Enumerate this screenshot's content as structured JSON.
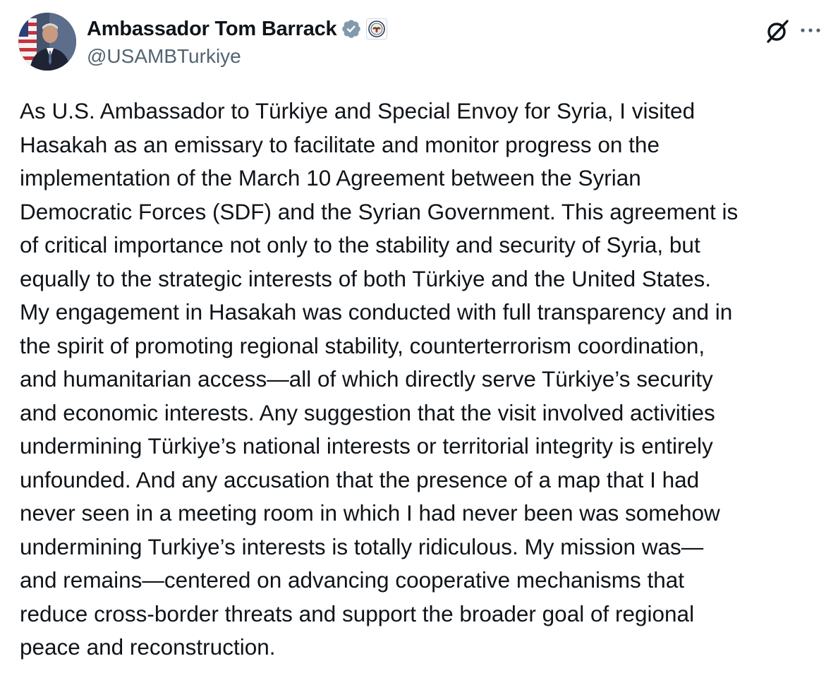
{
  "author": {
    "display_name": "Ambassador Tom Barrack",
    "handle": "@USAMBTurkiye",
    "verified_badge": "verified-icon",
    "affiliation_badge": "us-state-department-seal-icon"
  },
  "actions": {
    "grok_icon": "grok-icon",
    "more_icon": "more-icon"
  },
  "colors": {
    "text": "#0f1419",
    "secondary_text": "#536471",
    "verified_badge": "#829aab"
  },
  "tweet": {
    "lines": [
      "As U.S. Ambassador to Türkiye and Special Envoy for Syria, I visited",
      "Hasakah as an emissary to facilitate and monitor progress on the",
      "implementation of the March 10 Agreement between the Syrian",
      "Democratic Forces (SDF) and the Syrian Government. This agreement is",
      "of critical importance not only to the stability and security of Syria, but",
      "equally to the strategic interests of both Türkiye and the United States.",
      "My engagement in Hasakah was conducted with full transparency and in",
      "the spirit of promoting regional stability, counterterrorism coordination,",
      "and humanitarian access—all of which directly serve Türkiye’s security",
      "and economic interests. Any suggestion that the visit involved activities",
      "undermining Türkiye’s national interests or territorial integrity is entirely",
      "unfounded. And any accusation that the presence of a map that I had",
      "never seen in a meeting room in which I had never been was somehow",
      "undermining Turkiye’s interests is totally ridiculous. My mission was—",
      "and remains—centered on advancing cooperative mechanisms that",
      "reduce cross-border threats and support the broader goal of regional",
      "peace and reconstruction."
    ]
  }
}
